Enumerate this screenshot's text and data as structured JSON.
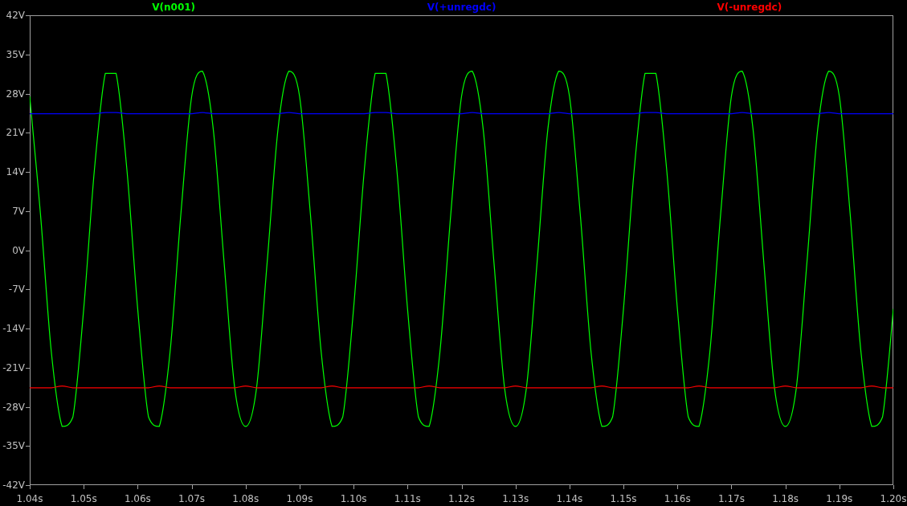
{
  "chart": {
    "chart_data": {
      "type": "line",
      "x": [
        1.04,
        1.042,
        1.044,
        1.046,
        1.048,
        1.05,
        1.052,
        1.054,
        1.056,
        1.058,
        1.06,
        1.062,
        1.064,
        1.066,
        1.068,
        1.07,
        1.072,
        1.074,
        1.076,
        1.078,
        1.08,
        1.082,
        1.084,
        1.086,
        1.088,
        1.09,
        1.092,
        1.094,
        1.096,
        1.098,
        1.1,
        1.102,
        1.104,
        1.106,
        1.108,
        1.11,
        1.112,
        1.114,
        1.116,
        1.118,
        1.12,
        1.122,
        1.124,
        1.126,
        1.128,
        1.13,
        1.132,
        1.134,
        1.136,
        1.138,
        1.14,
        1.142,
        1.144,
        1.146,
        1.148,
        1.15,
        1.152,
        1.154,
        1.156,
        1.158,
        1.16,
        1.162,
        1.164,
        1.166,
        1.168,
        1.17,
        1.172,
        1.174,
        1.176,
        1.178,
        1.18,
        1.182,
        1.184,
        1.186,
        1.188,
        1.19,
        1.192,
        1.194,
        1.196,
        1.198,
        1.2
      ],
      "series": [
        {
          "name": "V(n001)",
          "color": "#00ff00",
          "values": [
            27.5,
            6.4,
            -18.2,
            -31.5,
            -29.8,
            -10.5,
            14.5,
            31.6,
            31.6,
            14.5,
            -10.5,
            -29.8,
            -31.5,
            -18.2,
            6.4,
            27.5,
            32,
            21.7,
            -2.1,
            -24.8,
            -31.5,
            -24.8,
            -2.1,
            21.7,
            32,
            27.5,
            6.4,
            -18.2,
            -31.5,
            -29.8,
            -10.5,
            14.5,
            31.6,
            31.6,
            14.5,
            -10.5,
            -29.8,
            -31.5,
            -18.2,
            6.4,
            27.5,
            32,
            21.7,
            -2.1,
            -24.8,
            -31.5,
            -24.8,
            -2.1,
            21.7,
            32,
            27.5,
            6.4,
            -18.2,
            -31.5,
            -29.8,
            -10.5,
            14.5,
            31.6,
            31.6,
            14.5,
            -10.5,
            -29.8,
            -31.5,
            -18.2,
            6.4,
            27.5,
            32,
            21.7,
            -2.1,
            -24.8,
            -31.5,
            -24.8,
            -2.1,
            21.7,
            32,
            27.5,
            6.4,
            -18.2,
            -31.5,
            -29.8,
            -10.5
          ]
        },
        {
          "name": "V(+unregdc)",
          "color": "#0000ff",
          "values": [
            24.4,
            24.4,
            24.4,
            24.4,
            24.4,
            24.4,
            24.4,
            24.6,
            24.6,
            24.4,
            24.4,
            24.4,
            24.4,
            24.4,
            24.4,
            24.4,
            24.6,
            24.4,
            24.4,
            24.4,
            24.4,
            24.4,
            24.4,
            24.4,
            24.6,
            24.4,
            24.4,
            24.4,
            24.4,
            24.4,
            24.4,
            24.4,
            24.6,
            24.6,
            24.4,
            24.4,
            24.4,
            24.4,
            24.4,
            24.4,
            24.4,
            24.6,
            24.4,
            24.4,
            24.4,
            24.4,
            24.4,
            24.4,
            24.4,
            24.6,
            24.4,
            24.4,
            24.4,
            24.4,
            24.4,
            24.4,
            24.4,
            24.6,
            24.6,
            24.4,
            24.4,
            24.4,
            24.4,
            24.4,
            24.4,
            24.4,
            24.6,
            24.4,
            24.4,
            24.4,
            24.4,
            24.4,
            24.4,
            24.4,
            24.6,
            24.4,
            24.4,
            24.4,
            24.4,
            24.4,
            24.4
          ]
        },
        {
          "name": "V(-unregdc)",
          "color": "#ff0000",
          "values": [
            -24.6,
            -24.6,
            -24.6,
            -24.3,
            -24.6,
            -24.6,
            -24.6,
            -24.6,
            -24.6,
            -24.6,
            -24.6,
            -24.6,
            -24.3,
            -24.6,
            -24.6,
            -24.6,
            -24.6,
            -24.6,
            -24.6,
            -24.6,
            -24.3,
            -24.6,
            -24.6,
            -24.6,
            -24.6,
            -24.6,
            -24.6,
            -24.6,
            -24.3,
            -24.6,
            -24.6,
            -24.6,
            -24.6,
            -24.6,
            -24.6,
            -24.6,
            -24.6,
            -24.3,
            -24.6,
            -24.6,
            -24.6,
            -24.6,
            -24.6,
            -24.6,
            -24.6,
            -24.3,
            -24.6,
            -24.6,
            -24.6,
            -24.6,
            -24.6,
            -24.6,
            -24.6,
            -24.3,
            -24.6,
            -24.6,
            -24.6,
            -24.6,
            -24.6,
            -24.6,
            -24.6,
            -24.6,
            -24.3,
            -24.6,
            -24.6,
            -24.6,
            -24.6,
            -24.6,
            -24.6,
            -24.6,
            -24.3,
            -24.6,
            -24.6,
            -24.6,
            -24.6,
            -24.6,
            -24.6,
            -24.6,
            -24.3,
            -24.6,
            -24.6
          ]
        }
      ],
      "xlim": [
        1.04,
        1.2
      ],
      "ylim": [
        -42,
        42
      ],
      "xticks": [
        {
          "value": 1.04,
          "label": "1.04s"
        },
        {
          "value": 1.05,
          "label": "1.05s"
        },
        {
          "value": 1.06,
          "label": "1.06s"
        },
        {
          "value": 1.07,
          "label": "1.07s"
        },
        {
          "value": 1.08,
          "label": "1.08s"
        },
        {
          "value": 1.09,
          "label": "1.09s"
        },
        {
          "value": 1.1,
          "label": "1.10s"
        },
        {
          "value": 1.11,
          "label": "1.11s"
        },
        {
          "value": 1.12,
          "label": "1.12s"
        },
        {
          "value": 1.13,
          "label": "1.13s"
        },
        {
          "value": 1.14,
          "label": "1.14s"
        },
        {
          "value": 1.15,
          "label": "1.15s"
        },
        {
          "value": 1.16,
          "label": "1.16s"
        },
        {
          "value": 1.17,
          "label": "1.17s"
        },
        {
          "value": 1.18,
          "label": "1.18s"
        },
        {
          "value": 1.19,
          "label": "1.19s"
        },
        {
          "value": 1.2,
          "label": "1.20s"
        }
      ],
      "yticks": [
        {
          "value": 42,
          "label": "42V"
        },
        {
          "value": 35,
          "label": "35V"
        },
        {
          "value": 28,
          "label": "28V"
        },
        {
          "value": 21,
          "label": "21V"
        },
        {
          "value": 14,
          "label": "14V"
        },
        {
          "value": 7,
          "label": "7V"
        },
        {
          "value": 0,
          "label": "0V"
        },
        {
          "value": -7,
          "label": "-7V"
        },
        {
          "value": -14,
          "label": "-14V"
        },
        {
          "value": -21,
          "label": "-21V"
        },
        {
          "value": -28,
          "label": "-28V"
        },
        {
          "value": -35,
          "label": "-35V"
        },
        {
          "value": -42,
          "label": "-42V"
        }
      ]
    }
  }
}
